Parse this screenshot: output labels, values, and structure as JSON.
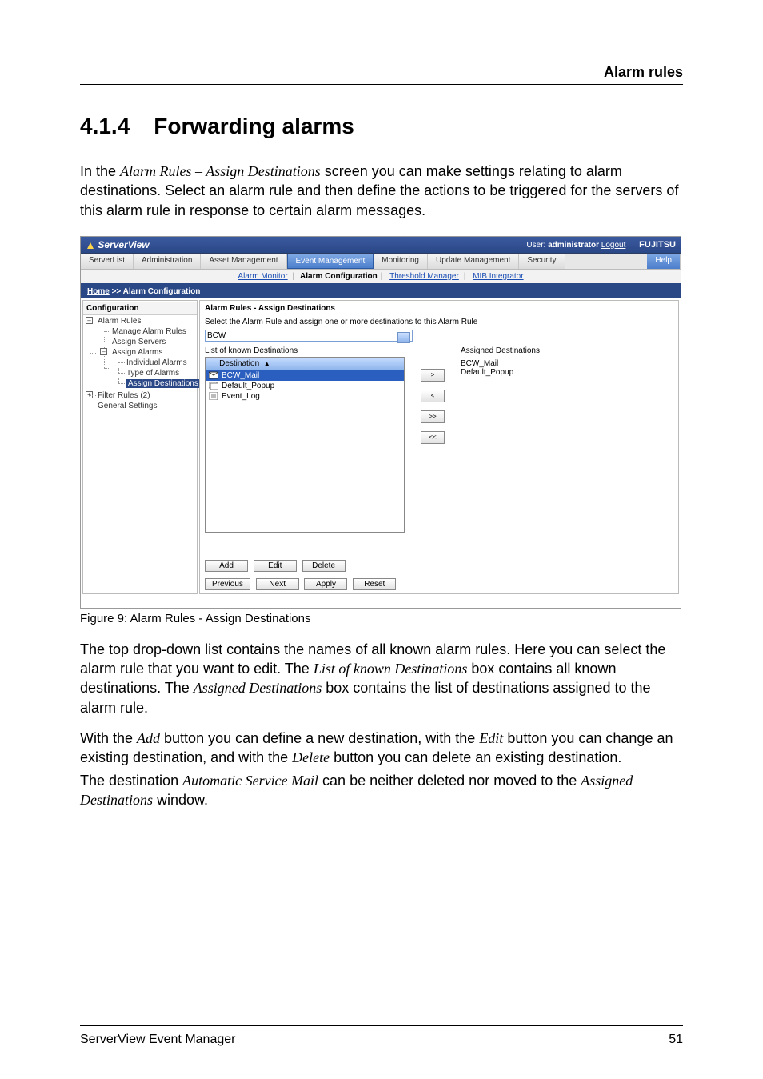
{
  "page": {
    "header_right": "Alarm rules",
    "section_number": "4.1.4",
    "section_title": "Forwarding alarms",
    "para1_a": "In the ",
    "para1_i1": "Alarm Rules – Assign Destinations",
    "para1_b": " screen you can make settings relating to alarm destinations. Select an alarm rule and then define the actions to be triggered for the servers of this alarm rule in response to certain alarm messages.",
    "caption": "Figure 9: Alarm Rules - Assign Destinations",
    "para2_a": "The top drop-down list contains the names of all known alarm rules. Here you can select the alarm rule that you want to edit. The ",
    "para2_i1": "List of known Destinations",
    "para2_b": " box contains all known destinations. The ",
    "para2_i2": "Assigned Destinations",
    "para2_c": " box contains the list of destinations assigned to the alarm rule.",
    "para3_a": "With the ",
    "para3_i1": "Add",
    "para3_b": " button you can define a new destination, with the ",
    "para3_i2": "Edit",
    "para3_c": " button you can change an existing destination, and with the ",
    "para3_i3": "Delete",
    "para3_d": " button you can delete an existing destination.",
    "para4_a": "The destination ",
    "para4_i1": "Automatic Service Mail",
    "para4_b": " can be neither deleted nor moved to the ",
    "para4_i2": "Assigned Destinations",
    "para4_c": " window.",
    "footer_left": "ServerView Event Manager",
    "footer_right": "51"
  },
  "app": {
    "brand": "ServerView",
    "user_label": "User:",
    "user_name": "administrator",
    "logout": "Logout",
    "fujitsu": "FUJITSU",
    "main_tabs": [
      "ServerList",
      "Administration",
      "Asset Management",
      "Event Management",
      "Monitoring",
      "Update Management",
      "Security"
    ],
    "active_main_tab": 3,
    "help": "Help",
    "sub_tabs": [
      "Alarm Monitor",
      "Alarm Configuration",
      "Threshold Manager",
      "MIB Integrator"
    ],
    "active_sub_tab": 1,
    "breadcrumb_home": "Home",
    "breadcrumb_current": "Alarm Configuration"
  },
  "sidebar": {
    "title": "Configuration",
    "tree": {
      "alarm_rules": "Alarm Rules",
      "manage_alarm_rules": "Manage Alarm Rules",
      "assign_servers": "Assign Servers",
      "assign_alarms": "Assign Alarms",
      "individual_alarms": "Individual Alarms",
      "type_of_alarms": "Type of Alarms",
      "assign_destinations": "Assign Destinations",
      "filter_rules": "Filter Rules (2)",
      "general_settings": "General Settings"
    }
  },
  "main": {
    "title": "Alarm Rules - Assign Destinations",
    "instruction": "Select the Alarm Rule and assign one or more destinations to this Alarm Rule",
    "selected_rule": "BCW",
    "known_label": "List of known Destinations",
    "dest_col": "Destination",
    "known_items": [
      "BCW_Mail",
      "Default_Popup",
      "Event_Log"
    ],
    "assigned_label": "Assigned Destinations",
    "assigned_items": [
      "BCW_Mail",
      "Default_Popup"
    ],
    "xfer": {
      "right": ">",
      "left": "<",
      "all_right": ">>",
      "all_left": "<<"
    },
    "buttons": {
      "add": "Add",
      "edit": "Edit",
      "delete": "Delete",
      "previous": "Previous",
      "next": "Next",
      "apply": "Apply",
      "reset": "Reset"
    }
  }
}
